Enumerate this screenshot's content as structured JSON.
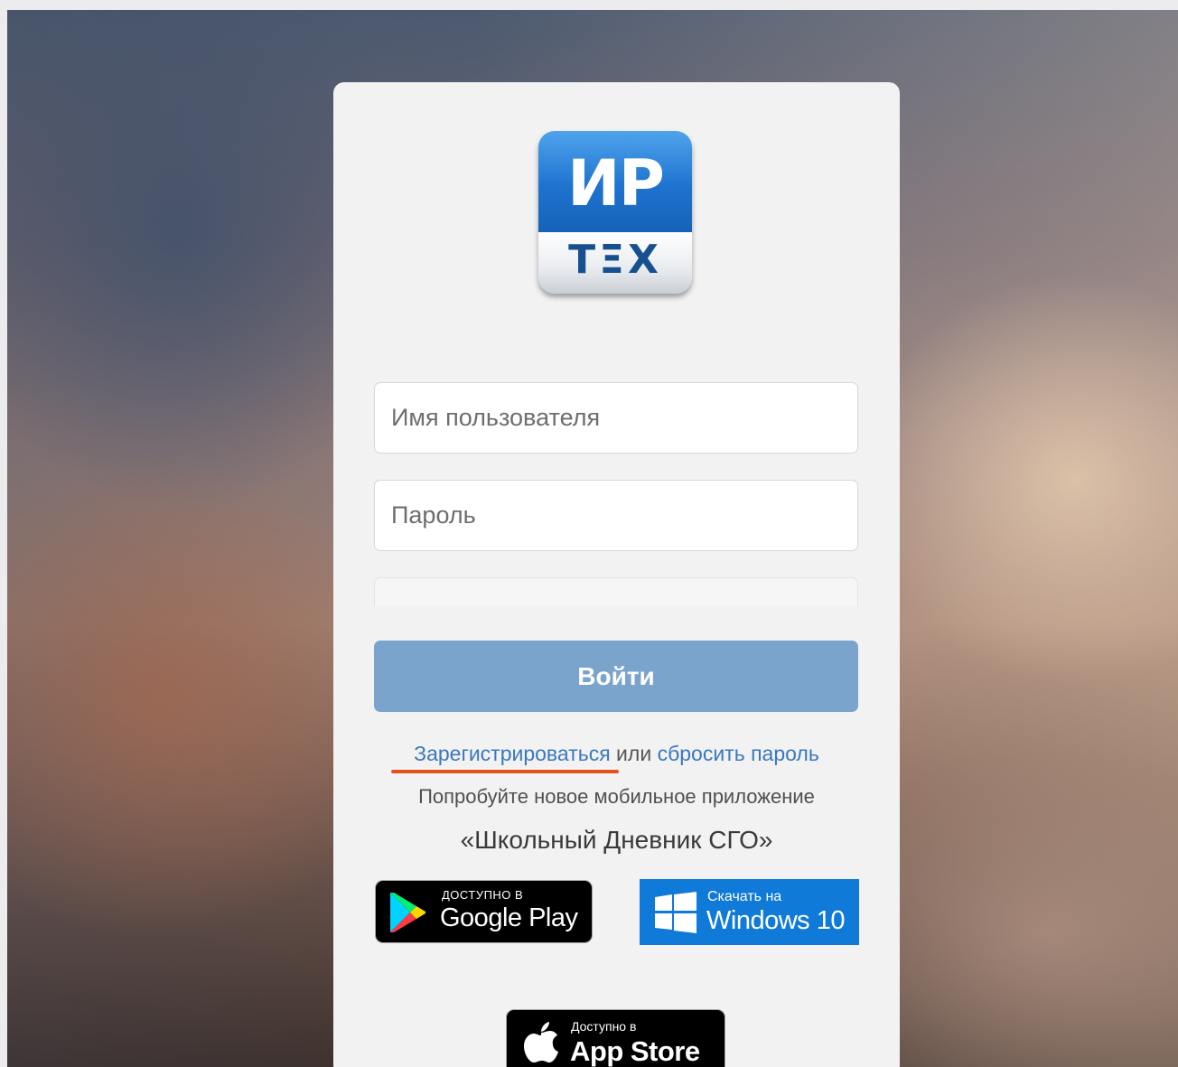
{
  "logo": {
    "top_text": "ИР",
    "bottom_text": "ТΞХ"
  },
  "login_form": {
    "username_placeholder": "Имя пользователя",
    "password_placeholder": "Пароль",
    "submit_label": "Войти"
  },
  "links": {
    "register_label": "Зарегистрироваться",
    "separator": "или",
    "reset_label": "сбросить пароль"
  },
  "promo": {
    "try_text": "Попробуйте новое мобильное приложение",
    "app_name": "«Школьный Дневник СГО»"
  },
  "badges": {
    "google_play": {
      "small": "доступно в",
      "big": "Google Play"
    },
    "windows": {
      "small": "Скачать на",
      "big": "Windows 10"
    },
    "app_store": {
      "small": "Доступно в",
      "big": "App Store"
    }
  },
  "colors": {
    "login_button": "#7aa4cc",
    "link": "#3a78c0",
    "register_underline": "#e3521c",
    "windows_badge": "#0f7ad8",
    "logo_blue": "#1e73cf"
  }
}
